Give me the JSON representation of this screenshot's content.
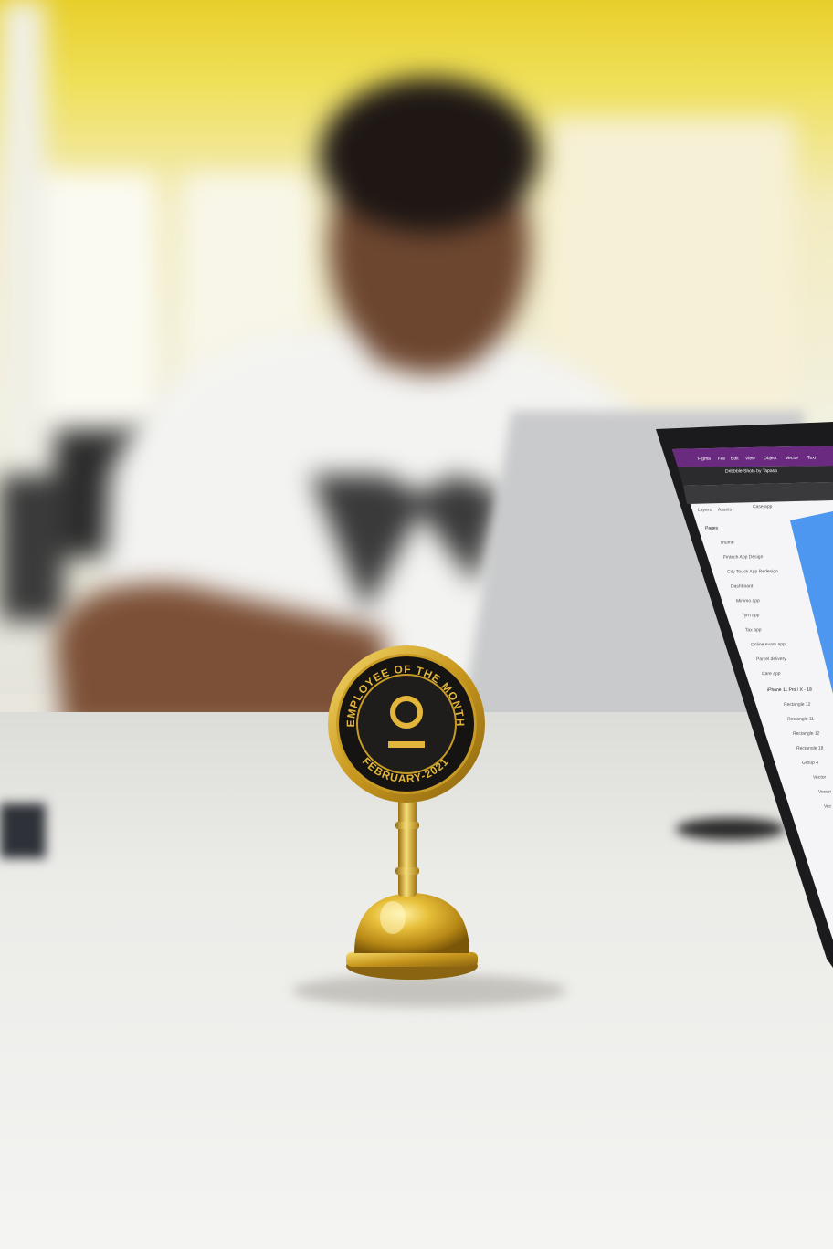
{
  "trophy": {
    "top_text": "EMPLOYEE OF THE MONTH",
    "bottom_text": "FEBRUARY-2021"
  },
  "laptop_screen": {
    "menu": [
      "Figma",
      "File",
      "Edit",
      "View",
      "Object",
      "Vector",
      "Text"
    ],
    "file_title": "Dribbble Shots by Tapasa",
    "panel_tabs": [
      "Layers",
      "Assets",
      "Case app"
    ],
    "pages_heading": "Pages",
    "pages": [
      "Thumb",
      "Fintech App Design",
      "City Touch App Redesign",
      "Dashboard",
      "Minimo app",
      "Tyrn app",
      "Tax app",
      "Online exam app",
      "Parcel delivery",
      "Care app"
    ],
    "frame_name": "iPhone 11 Pro / X - 18",
    "layers": [
      "Rectangle 12",
      "Rectangle 11",
      "Rectangle 12",
      "Rectangle 18",
      "Group 4",
      "Vector",
      "Vector",
      "Vec"
    ]
  },
  "colors": {
    "wall_yellow": "#e8cf2a",
    "gold": "#d4a82a",
    "badge_black": "#161514",
    "figma_purple": "#6a2a80"
  }
}
